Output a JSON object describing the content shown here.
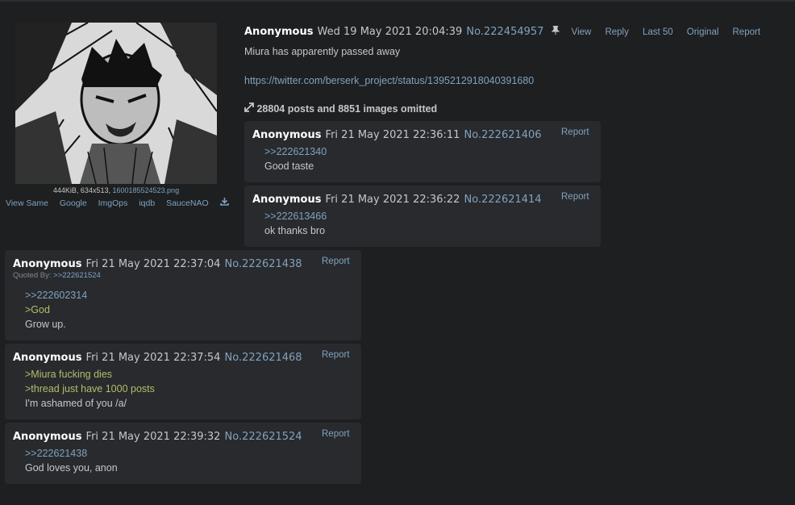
{
  "op": {
    "file": {
      "size_dims": "444KiB, 634x513,",
      "filename": "1600185524523.png"
    },
    "search": [
      "View Same",
      "Google",
      "ImgOps",
      "iqdb",
      "SauceNAO"
    ],
    "name": "Anonymous",
    "date": "Wed 19 May 2021 20:04:39",
    "number": "No.222454957",
    "controls": {
      "view": "View",
      "reply": "Reply",
      "last50": "Last 50",
      "original": "Original",
      "report": "Report"
    },
    "body": {
      "line1": "Miura has apparently passed away",
      "link": "https://twitter.com/berserk_project/status/1395212918040391680"
    },
    "omitted": "28804 posts and 8851 images omitted"
  },
  "replies": [
    {
      "name": "Anonymous",
      "date": "Fri 21 May 2021 22:36:11",
      "number": "No.222621406",
      "report": "Report",
      "lines": [
        ">>222621340",
        "Good taste"
      ]
    },
    {
      "name": "Anonymous",
      "date": "Fri 21 May 2021 22:36:22",
      "number": "No.222621414",
      "report": "Report",
      "lines": [
        ">>222613466",
        "ok thanks bro"
      ]
    },
    {
      "name": "Anonymous",
      "date": "Fri 21 May 2021 22:37:04",
      "number": "No.222621438",
      "report": "Report",
      "quoted_by_label": "Quoted By:",
      "quoted_by": ">>222621524",
      "lines": [
        ">>222602314",
        ">God",
        "Grow up."
      ]
    },
    {
      "name": "Anonymous",
      "date": "Fri 21 May 2021 22:37:54",
      "number": "No.222621468",
      "report": "Report",
      "lines": [
        ">Miura fucking dies",
        ">thread just have 1000 posts",
        "I'm ashamed of you /a/"
      ]
    },
    {
      "name": "Anonymous",
      "date": "Fri 21 May 2021 22:39:32",
      "number": "No.222621524",
      "report": "Report",
      "lines": [
        ">>222621438",
        "God loves you, anon"
      ]
    }
  ],
  "icons": {
    "pin": "pin-icon",
    "download": "download-icon",
    "expand": "expand-arrows-icon"
  },
  "colors": {
    "background": "#1d1f21",
    "post_bg": "#282a2e",
    "link": "#81a2be",
    "greentext": "#b5bd68",
    "name": "#ffffff"
  }
}
